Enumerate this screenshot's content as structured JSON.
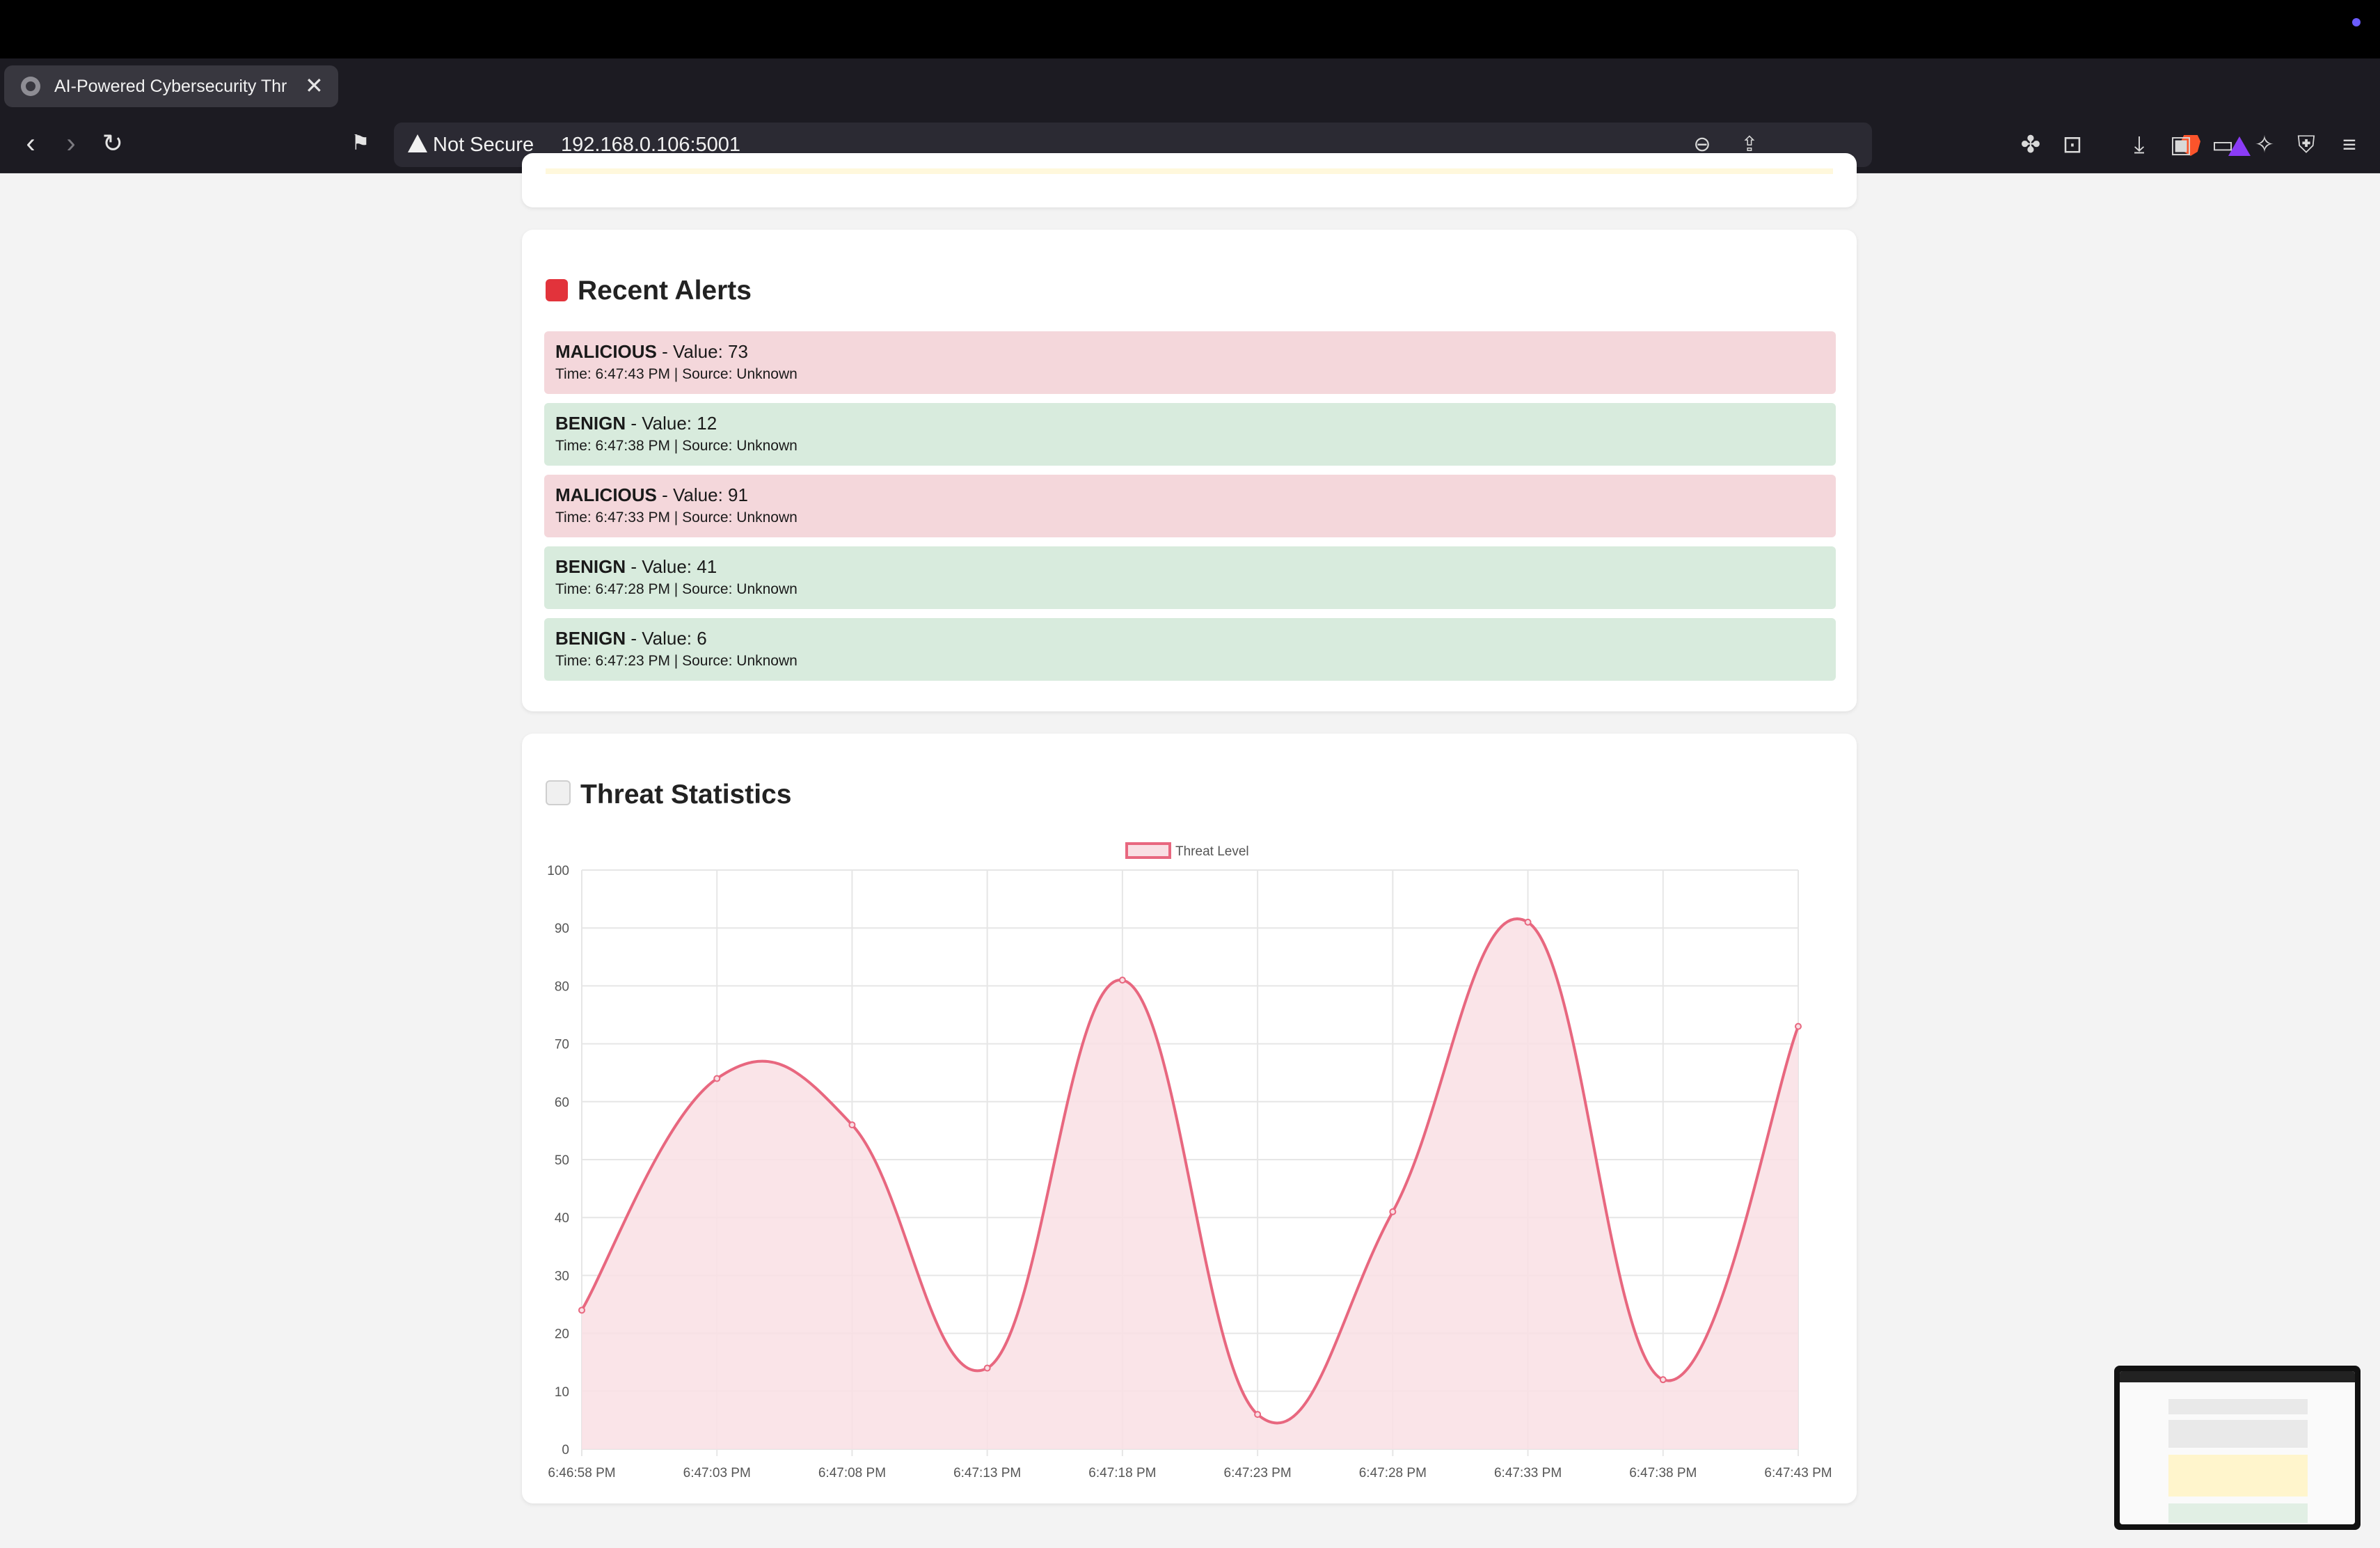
{
  "browser": {
    "tab_title": "AI-Powered Cybersecurity Thr",
    "tab_close": "✕",
    "new_tab": "+",
    "security_label": "Not Secure",
    "url": "192.168.0.106:5001"
  },
  "alerts_section": {
    "title": "Recent Alerts",
    "icon": "siren-icon",
    "items": [
      {
        "type": "MALICIOUS",
        "value_text": " - Value: 73",
        "meta": "Time: 6:47:43 PM | Source: Unknown",
        "status": "malicious"
      },
      {
        "type": "BENIGN",
        "value_text": " - Value: 12",
        "meta": "Time: 6:47:38 PM | Source: Unknown",
        "status": "benign"
      },
      {
        "type": "MALICIOUS",
        "value_text": " - Value: 91",
        "meta": "Time: 6:47:33 PM | Source: Unknown",
        "status": "malicious"
      },
      {
        "type": "BENIGN",
        "value_text": " - Value: 41",
        "meta": "Time: 6:47:28 PM | Source: Unknown",
        "status": "benign"
      },
      {
        "type": "BENIGN",
        "value_text": " - Value: 6",
        "meta": "Time: 6:47:23 PM | Source: Unknown",
        "status": "benign"
      }
    ]
  },
  "stats_section": {
    "title": "Threat Statistics",
    "icon": "chart-increasing-icon"
  },
  "colors": {
    "line": "#e8677f",
    "fill": "#f9dfe4",
    "malicious_bg": "#f4d7db",
    "benign_bg": "#d8ebdd"
  },
  "chart_data": {
    "type": "area",
    "legend": [
      "Threat Level"
    ],
    "legend_position": "top",
    "x": [
      "6:46:58 PM",
      "6:47:03 PM",
      "6:47:08 PM",
      "6:47:13 PM",
      "6:47:18 PM",
      "6:47:23 PM",
      "6:47:28 PM",
      "6:47:33 PM",
      "6:47:38 PM",
      "6:47:43 PM"
    ],
    "series": [
      {
        "name": "Threat Level",
        "values": [
          24,
          64,
          56,
          14,
          81,
          6,
          41,
          91,
          12,
          73
        ]
      }
    ],
    "ylim": [
      0,
      100
    ],
    "yticks": [
      0,
      10,
      20,
      30,
      40,
      50,
      60,
      70,
      80,
      90,
      100
    ],
    "grid": true
  }
}
